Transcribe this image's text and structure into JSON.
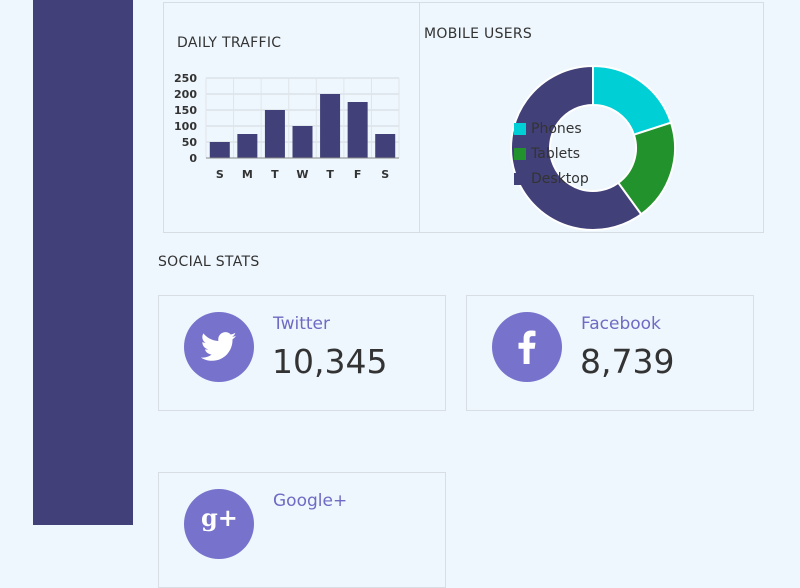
{
  "daily_traffic": {
    "title": "DAILY TRAFFIC"
  },
  "mobile_users": {
    "title": "MOBILE USERS"
  },
  "social": {
    "title": "SOCIAL STATS",
    "twitter": {
      "label": "Twitter",
      "value": "10,345",
      "icon": "twitter-bird-icon"
    },
    "facebook": {
      "label": "Facebook",
      "value": "8,739",
      "icon": "facebook-f-icon"
    },
    "googleplus": {
      "label": "Google+",
      "icon": "google-plus-icon"
    }
  },
  "colors": {
    "sidebar": "#424078",
    "bar": "#424078",
    "phones": "#00cfd6",
    "tablets": "#22922d",
    "desktop": "#424078",
    "icon_circle": "#7772cc"
  },
  "chart_data": [
    {
      "type": "bar",
      "title": "DAILY TRAFFIC",
      "categories": [
        "S",
        "M",
        "T",
        "W",
        "T",
        "F",
        "S"
      ],
      "values": [
        50,
        75,
        150,
        100,
        200,
        175,
        75
      ],
      "ylim": [
        0,
        250
      ],
      "yticks": [
        0,
        50,
        100,
        150,
        200,
        250
      ],
      "grid": true
    },
    {
      "type": "pie",
      "title": "MOBILE USERS",
      "donut": true,
      "legend_position": "right",
      "labels": [
        "Phones",
        "Tablets",
        "Desktop"
      ],
      "values": [
        20,
        20,
        60
      ]
    }
  ]
}
